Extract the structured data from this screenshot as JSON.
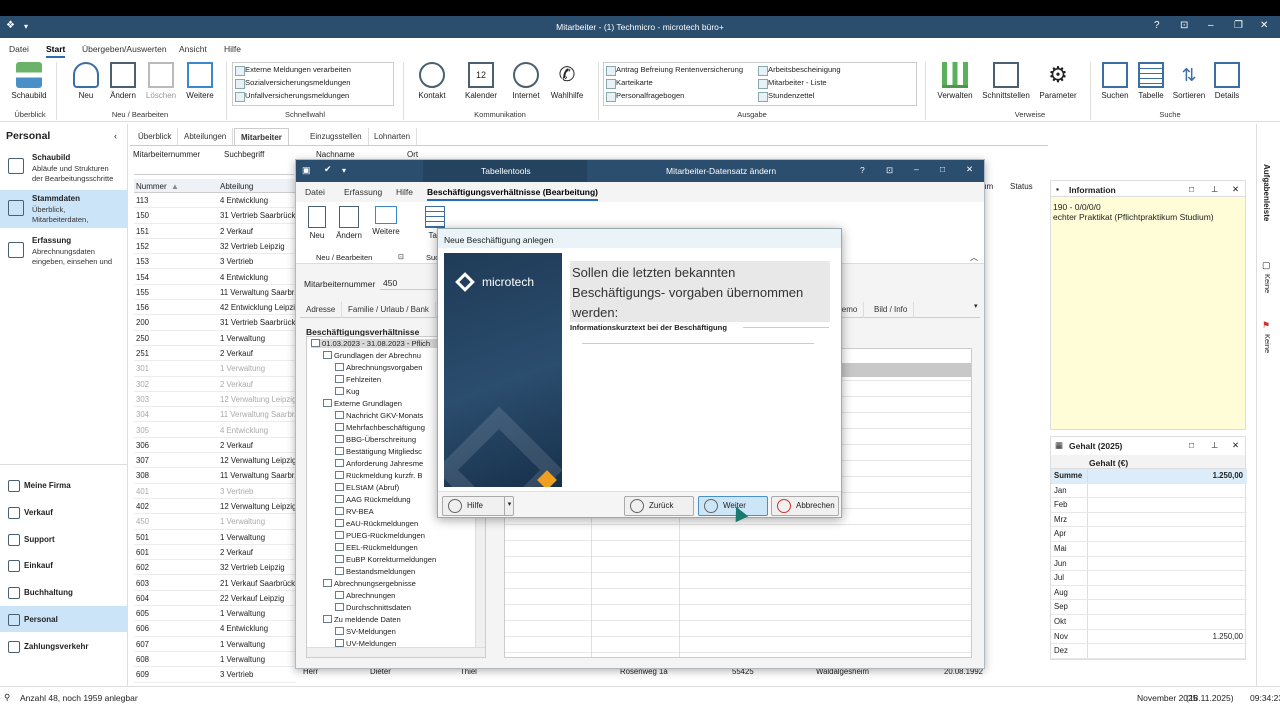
{
  "window": {
    "title": "Mitarbeiter - (1) Techmicro - microtech büro+",
    "help": "?"
  },
  "menu": [
    "Datei",
    "Start",
    "Übergeben/Auswerten",
    "Ansicht",
    "Hilfe"
  ],
  "ribbon": {
    "schaubild": "Schaubild",
    "neu": "Neu",
    "aendern": "Ändern",
    "loeschen": "Löschen",
    "weitere": "Weitere",
    "schnellwahl": [
      "Externe Meldungen verarbeiten",
      "Sozialversicherungsmeldungen",
      "Unfallversicherungsmeldungen"
    ],
    "kontakt": "Kontakt",
    "kalender": "Kalender",
    "internet": "Internet",
    "wahlhilfe": "Wahlhilfe",
    "ausgabe_col1": [
      "Antrag Befreiung Rentenversicherung",
      "Karteikarte",
      "Personalfragebogen"
    ],
    "ausgabe_col2": [
      "Arbeitsbescheinigung",
      "Mitarbeiter - Liste",
      "Stundenzettel"
    ],
    "verwalten": "Verwalten",
    "schnittstellen": "Schnittstellen",
    "parameter": "Parameter",
    "suchen": "Suchen",
    "tabelle": "Tabelle",
    "sortieren": "Sortieren",
    "details": "Details",
    "groups": {
      "ueberblick": "Überblick",
      "neu_bearbeiten": "Neu / Bearbeiten",
      "schnellwahl": "Schnellwahl",
      "kommunikation": "Kommunikation",
      "ausgabe": "Ausgabe",
      "verweise": "Verweise",
      "suche": "Suche"
    }
  },
  "left": {
    "title": "Personal",
    "items": [
      {
        "h": "Schaubild",
        "d1": "Abläufe und Strukturen",
        "d2": "der Bearbeitungsschritte"
      },
      {
        "h": "Stammdaten",
        "d1": "Überblick,",
        "d2": "Mitarbeiterdaten,"
      },
      {
        "h": "Erfassung",
        "d1": "Abrechnungsdaten",
        "d2": "eingeben, einsehen und"
      }
    ],
    "bottom": [
      "Meine Firma",
      "Verkauf",
      "Support",
      "Einkauf",
      "Buchhaltung",
      "Personal",
      "Zahlungsverkehr"
    ]
  },
  "content": {
    "tabs": [
      "Überblick",
      "Abteilungen",
      "Mitarbeiter",
      "Einzugsstellen",
      "Lohnarten"
    ],
    "filters": [
      "Mitarbeiternummer",
      "Suchbegriff",
      "Nachname",
      "Ort"
    ],
    "cols": {
      "nummer": "Nummer",
      "abteilung": "Abteilung",
      "status": "Status"
    },
    "rows": [
      [
        "113",
        "4 Entwicklung",
        false
      ],
      [
        "150",
        "31 Vertrieb Saarbrück",
        false
      ],
      [
        "151",
        "2 Verkauf",
        false
      ],
      [
        "152",
        "32 Vertrieb Leipzig",
        false
      ],
      [
        "153",
        "3 Vertrieb",
        false
      ],
      [
        "154",
        "4 Entwicklung",
        false
      ],
      [
        "155",
        "11 Verwaltung Saarbr.",
        false
      ],
      [
        "156",
        "42 Entwicklung Leipzi",
        false
      ],
      [
        "200",
        "31 Vertrieb Saarbrück",
        false
      ],
      [
        "250",
        "1 Verwaltung",
        false
      ],
      [
        "251",
        "2 Verkauf",
        false
      ],
      [
        "301",
        "1 Verwaltung",
        true
      ],
      [
        "302",
        "2 Verkauf",
        true
      ],
      [
        "303",
        "12 Verwaltung Leipzig",
        true
      ],
      [
        "304",
        "11 Verwaltung Saarbr.",
        true
      ],
      [
        "305",
        "4 Entwicklung",
        true
      ],
      [
        "306",
        "2 Verkauf",
        false
      ],
      [
        "307",
        "12 Verwaltung Leipzig",
        false
      ],
      [
        "308",
        "11 Verwaltung Saarbr.",
        false
      ],
      [
        "401",
        "3 Vertrieb",
        true
      ],
      [
        "402",
        "12 Verwaltung Leipzig",
        false
      ],
      [
        "450",
        "1 Verwaltung",
        true
      ],
      [
        "501",
        "1 Verwaltung",
        false
      ],
      [
        "601",
        "2 Verkauf",
        false
      ],
      [
        "602",
        "32 Vertrieb Leipzig",
        false
      ],
      [
        "603",
        "21 Verkauf Saarbrück",
        false
      ],
      [
        "604",
        "22 Verkauf Leipzig",
        false
      ],
      [
        "605",
        "1 Verwaltung",
        false
      ],
      [
        "606",
        "4 Entwicklung",
        false
      ],
      [
        "607",
        "1 Verwaltung",
        false
      ],
      [
        "608",
        "1 Verwaltung",
        false
      ],
      [
        "609",
        "3 Vertrieb",
        false
      ]
    ],
    "lastrow": {
      "anrede": "Herr",
      "vorname": "Dieter",
      "nachname": "Thiel",
      "strasse": "Rosenweg 1a",
      "plz": "55425",
      "ort": "Waldalgesheim",
      "datum": "20.08.1992"
    }
  },
  "dialog": {
    "title": "Mitarbeiter-Datensatz ändern",
    "tabletools": "Tabellentools",
    "help": "?",
    "menu": [
      "Datei",
      "Erfassung",
      "Hilfe",
      "Beschäftigungsverhältnisse (Bearbeitung)"
    ],
    "neu": "Neu",
    "aendern": "Ändern",
    "weitere": "Weitere",
    "tab": "Tab",
    "suc": "Suc",
    "group": "Neu / Bearbeiten",
    "nr_label": "Mitarbeiternummer",
    "nr_value": "450",
    "tabs": [
      "Adresse",
      "Familie / Urlaub / Bank",
      "lemo",
      "Bild / Info"
    ],
    "tree_title": "Beschäftigungsverhältnisse",
    "tree": [
      {
        "t": "01.03.2023 - 31.08.2023 - Pflich",
        "l": 0,
        "sel": true
      },
      {
        "t": "Grundlagen der Abrechnu",
        "l": 1
      },
      {
        "t": "Abrechnungsvorgaben",
        "l": 2
      },
      {
        "t": "Fehlzeiten",
        "l": 2
      },
      {
        "t": "Kug",
        "l": 2
      },
      {
        "t": "Externe Grundlagen",
        "l": 1
      },
      {
        "t": "Nachricht GKV-Monats",
        "l": 2
      },
      {
        "t": "Mehrfachbeschäftigung",
        "l": 2
      },
      {
        "t": "BBG-Überschreitung",
        "l": 2
      },
      {
        "t": "Bestätigung Mitgliedsc",
        "l": 2
      },
      {
        "t": "Anforderung Jahresme",
        "l": 2
      },
      {
        "t": "Rückmeldung kurzfr. B",
        "l": 2
      },
      {
        "t": "ELStAM (Abruf)",
        "l": 2
      },
      {
        "t": "AAG Rückmeldung",
        "l": 2
      },
      {
        "t": "RV-BEA",
        "l": 2
      },
      {
        "t": "eAU-Rückmeldungen",
        "l": 2
      },
      {
        "t": "PUEG-Rückmeldungen",
        "l": 2
      },
      {
        "t": "EEL-Rückmeldungen",
        "l": 2
      },
      {
        "t": "EuBP Korrekturmeldungen",
        "l": 2
      },
      {
        "t": "Bestandsmeldungen",
        "l": 2
      },
      {
        "t": "Abrechnungsergebnisse",
        "l": 1
      },
      {
        "t": "Abrechnungen",
        "l": 2
      },
      {
        "t": "Durchschnittsdaten",
        "l": 2
      },
      {
        "t": "Zu meldende Daten",
        "l": 1
      },
      {
        "t": "SV-Meldungen",
        "l": 2
      },
      {
        "t": "UV-Meldungen",
        "l": 2
      }
    ]
  },
  "wizard": {
    "title": "Neue Beschäftigung anlegen",
    "brand": "microtech",
    "question": "Sollen die letzten bekannten Beschäftigungs- vorgaben übernommen werden:",
    "sublabel": "Informationskurztext bei der Beschäftigung",
    "hilfe": "Hilfe",
    "zurueck": "Zurück",
    "weiter": "Weiter",
    "abbrechen": "Abbrechen"
  },
  "info": {
    "title": "Information",
    "line1": "190 - 0/0/0/0",
    "line2": "echter Praktikat (Pflichtpraktikum Studium)"
  },
  "gehalt": {
    "title": "Gehalt (2025)",
    "col": "Gehalt (€)",
    "rows": [
      [
        "Summe",
        "1.250,00"
      ],
      [
        "Jan",
        ""
      ],
      [
        "Feb",
        ""
      ],
      [
        "Mrz",
        ""
      ],
      [
        "Apr",
        ""
      ],
      [
        "Mai",
        ""
      ],
      [
        "Jun",
        ""
      ],
      [
        "Jul",
        ""
      ],
      [
        "Aug",
        ""
      ],
      [
        "Sep",
        ""
      ],
      [
        "Okt",
        ""
      ],
      [
        "Nov",
        "1.250,00"
      ],
      [
        "Dez",
        ""
      ]
    ]
  },
  "rightbar": {
    "aufgaben": "Aufgabenleiste",
    "keine1": "Keine",
    "keine2": "Keine"
  },
  "status": {
    "left": "Anzahl 48, noch 1959 anlegbar",
    "date": "November 2025",
    "date2": "(18.11.2025)",
    "time": "09:34:23"
  },
  "dialog_col_header": "um"
}
